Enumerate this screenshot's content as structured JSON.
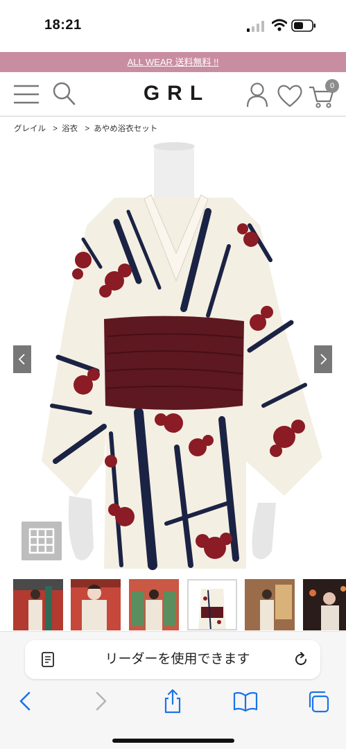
{
  "status_bar": {
    "time": "18:21",
    "icons": [
      "signal-icon",
      "wifi-icon",
      "battery-icon"
    ]
  },
  "promo": {
    "text": "ALL WEAR 送料無料 !!",
    "background": "#c98da1"
  },
  "header": {
    "logo": "GRL",
    "cart_count": "0",
    "icons": [
      "menu-icon",
      "search-icon",
      "account-icon",
      "heart-icon",
      "cart-icon"
    ]
  },
  "breadcrumb": {
    "items": [
      "グレイル",
      "浴衣",
      "あやめ浴衣セット"
    ],
    "separator": ">"
  },
  "gallery": {
    "image_subject": "product-image",
    "icons": [
      "chevron-left-icon",
      "chevron-right-icon",
      "grid-icon"
    ],
    "thumbnail_count": 6,
    "selected_thumbnail": 4
  },
  "safari": {
    "reader_text": "リーダーを使用できます",
    "icons": [
      "reader-icon",
      "reload-icon",
      "back-icon",
      "forward-icon",
      "share-icon",
      "bookmarks-icon",
      "tabs-icon"
    ]
  },
  "colors": {
    "accent_pink": "#c98da1",
    "obi_maroon": "#5e1820",
    "pattern_navy": "#1b2344",
    "flower_red": "#8b1b24",
    "fabric_cream": "#f4efe3",
    "ios_blue": "#1a73e8"
  }
}
